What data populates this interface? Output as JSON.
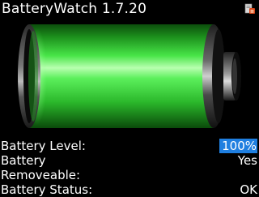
{
  "header": {
    "title": "BatteryWatch 1.7.20",
    "icon": "app-badge-icon"
  },
  "battery_graphic": {
    "level_percent": 100,
    "fill_color": "#2fcc2f",
    "icon": "battery-icon"
  },
  "info": {
    "rows": [
      {
        "label": "Battery Level:",
        "value": "100%"
      },
      {
        "label": "Battery",
        "value": "Yes"
      },
      {
        "label": "Removeable:",
        "value": ""
      },
      {
        "label": "Battery Status:",
        "value": "OK"
      }
    ]
  },
  "colors": {
    "background": "#000000",
    "selection": "#1f7fe0",
    "text": "#ffffff"
  }
}
